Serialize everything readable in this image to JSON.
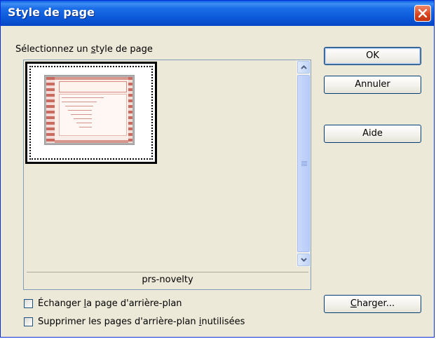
{
  "window": {
    "title": "Style de page"
  },
  "icons": {
    "close": "close-icon",
    "scroll_up": "arrow-up-icon",
    "scroll_down": "arrow-down-icon"
  },
  "select_label": {
    "before": "Sélectionnez un ",
    "mnemonic": "s",
    "after": "tyle de page"
  },
  "styles_list": {
    "items": [
      {
        "name": "prs-novelty",
        "selected": true
      }
    ],
    "caption": "prs-novelty"
  },
  "buttons": {
    "ok": "OK",
    "cancel": "Annuler",
    "help": "Aide",
    "load": {
      "mnemonic": "C",
      "after": "harger..."
    }
  },
  "options": {
    "exchange_background": {
      "before": "Échanger ",
      "mnemonic": "l",
      "after": "a page d'arrière-plan",
      "checked": false
    },
    "delete_unused": {
      "before": "Supprimer les pages d'arrière-plan ",
      "mnemonic": "i",
      "after": "nutilisées",
      "checked": false
    }
  },
  "colors": {
    "title_bar": "#0a58d8",
    "close_button": "#d8431c",
    "dialog_background": "#ece9d8",
    "thumbnail_accent": "#c96b60"
  }
}
